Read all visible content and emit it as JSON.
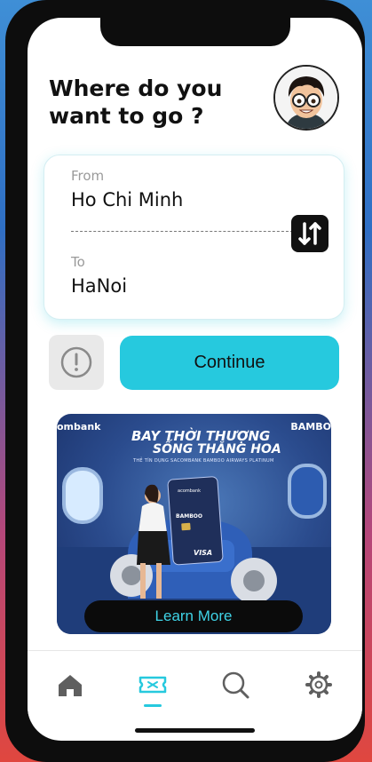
{
  "header": {
    "title_line1": "Where do you",
    "title_line2": "want to go ?"
  },
  "route": {
    "from_label": "From",
    "from_value": "Ho Chi Minh",
    "to_label": "To",
    "to_value": "HaNoi"
  },
  "actions": {
    "continue_label": "Continue"
  },
  "banner": {
    "bank_text": "ombank",
    "brand_text": "BAMBO",
    "headline_line1": "BAY THỜI THƯỢNG",
    "headline_line2": "SỐNG THĂNG HOA",
    "subheadline": "THẺ TÍN DỤNG SACOMBANK BAMBOO AIRWAYS PLATINUM",
    "card_issuer": "acombank",
    "card_brand": "BAMBOO",
    "card_network": "VISA",
    "learn_more_label": "Learn More"
  },
  "tabs": [
    {
      "icon": "home-icon",
      "active": false
    },
    {
      "icon": "ticket-icon",
      "active": true
    },
    {
      "icon": "search-icon",
      "active": false
    },
    {
      "icon": "gear-icon",
      "active": false
    }
  ],
  "colors": {
    "accent": "#26c9de",
    "text": "#111111",
    "muted": "#9a9a9a"
  }
}
